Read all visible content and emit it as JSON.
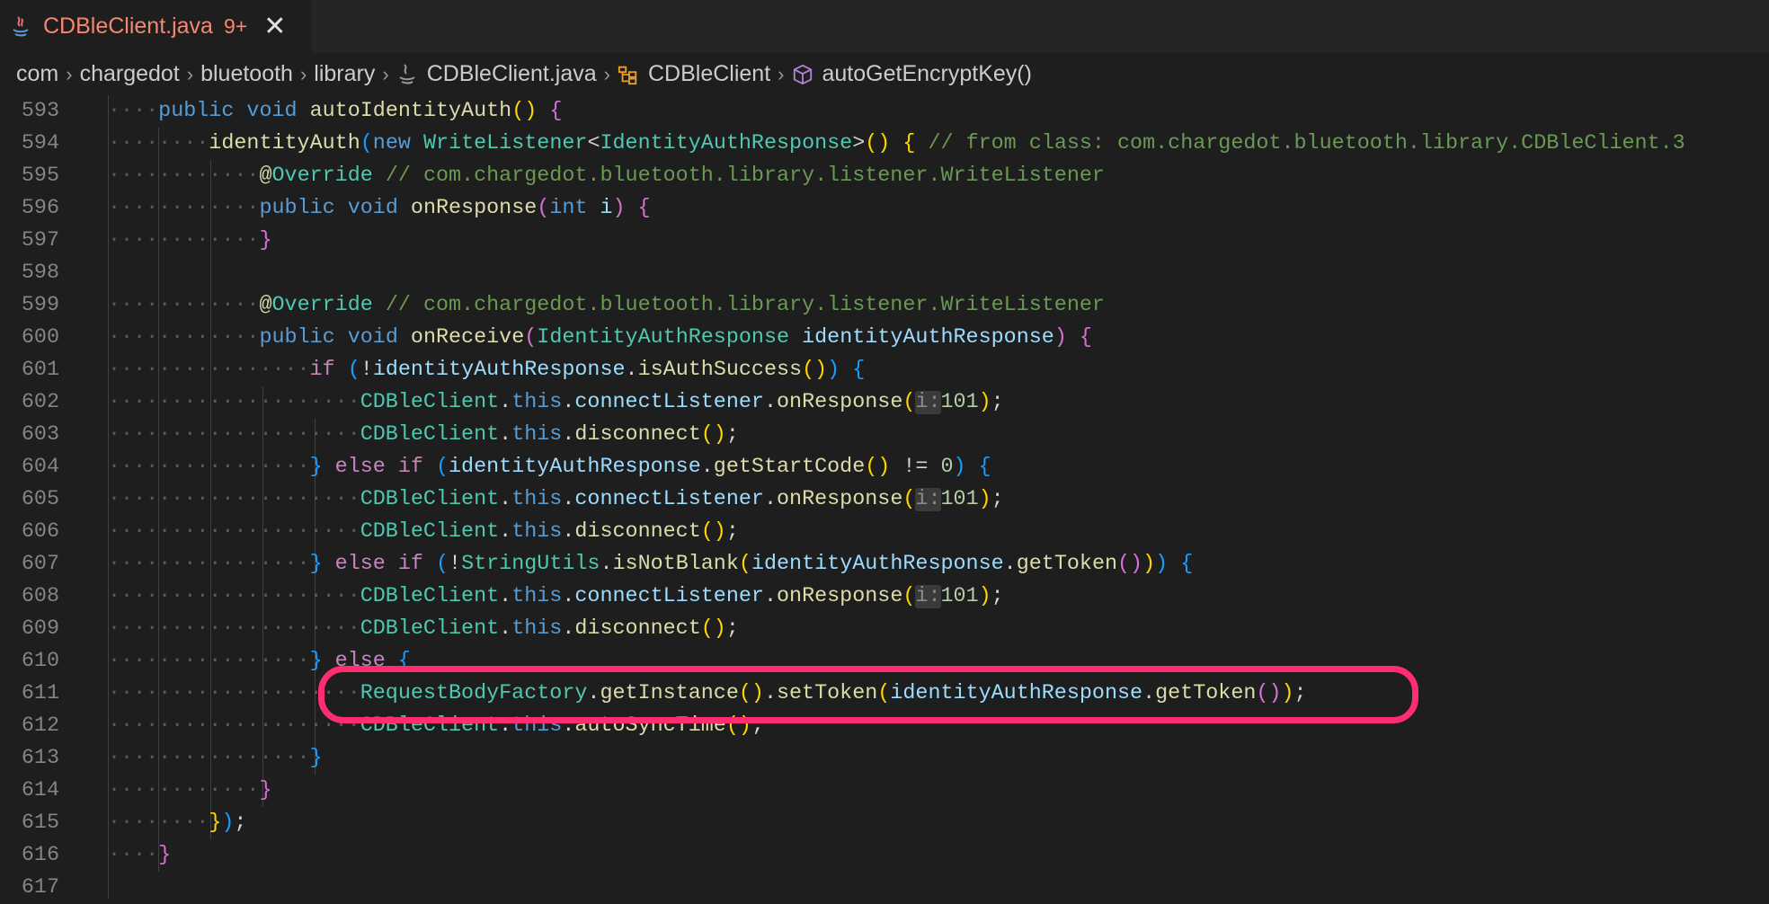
{
  "tab": {
    "title": "CDBleClient.java",
    "badge": "9+",
    "close": "✕"
  },
  "breadcrumb": {
    "items": [
      "com",
      "chargedot",
      "bluetooth",
      "library",
      "CDBleClient.java",
      "CDBleClient",
      "autoGetEncryptKey()"
    ]
  },
  "colors": {
    "highlight": "#ff2d6f",
    "tab_title": "#f48771"
  },
  "lines": [
    {
      "n": "593",
      "i": 1,
      "t": [
        [
          "kw",
          "public "
        ],
        [
          "kw",
          "void "
        ],
        [
          "fn",
          "autoIdentityAuth"
        ],
        [
          "b1",
          "() "
        ],
        [
          "b2",
          "{"
        ]
      ]
    },
    {
      "n": "594",
      "i": 2,
      "t": [
        [
          "fn",
          "identityAuth"
        ],
        [
          "b3",
          "("
        ],
        [
          "kw",
          "new "
        ],
        [
          "ty",
          "WriteListener"
        ],
        [
          "d",
          "<"
        ],
        [
          "ty",
          "IdentityAuthResponse"
        ],
        [
          "d",
          ">"
        ],
        [
          "b1",
          "() {"
        ],
        [
          "cm",
          " // from class: com.chargedot.bluetooth.library.CDBleClient.3"
        ]
      ]
    },
    {
      "n": "595",
      "i": 3,
      "t": [
        [
          "an",
          "@"
        ],
        [
          "ty",
          "Override"
        ],
        [
          "cm",
          " // com.chargedot.bluetooth.library.listener.WriteListener"
        ]
      ]
    },
    {
      "n": "596",
      "i": 3,
      "t": [
        [
          "kw",
          "public "
        ],
        [
          "kw",
          "void "
        ],
        [
          "fn",
          "onResponse"
        ],
        [
          "b2",
          "("
        ],
        [
          "kw",
          "int "
        ],
        [
          "var",
          "i"
        ],
        [
          "b2",
          ") {"
        ]
      ]
    },
    {
      "n": "597",
      "i": 3,
      "t": [
        [
          "b2",
          "}"
        ]
      ]
    },
    {
      "n": "598",
      "i": 0,
      "t": []
    },
    {
      "n": "599",
      "i": 3,
      "t": [
        [
          "an",
          "@"
        ],
        [
          "ty",
          "Override"
        ],
        [
          "cm",
          " // com.chargedot.bluetooth.library.listener.WriteListener"
        ]
      ]
    },
    {
      "n": "600",
      "i": 3,
      "t": [
        [
          "kw",
          "public "
        ],
        [
          "kw",
          "void "
        ],
        [
          "fn",
          "onReceive"
        ],
        [
          "b2",
          "("
        ],
        [
          "ty",
          "IdentityAuthResponse "
        ],
        [
          "var",
          "identityAuthResponse"
        ],
        [
          "b2",
          ") {"
        ]
      ]
    },
    {
      "n": "601",
      "i": 4,
      "t": [
        [
          "ctl",
          "if "
        ],
        [
          "b3",
          "("
        ],
        [
          "d",
          "!"
        ],
        [
          "var",
          "identityAuthResponse"
        ],
        [
          "d",
          "."
        ],
        [
          "fn",
          "isAuthSuccess"
        ],
        [
          "b1",
          "()"
        ],
        [
          "b3",
          ") {"
        ]
      ]
    },
    {
      "n": "602",
      "i": 5,
      "t": [
        [
          "ty",
          "CDBleClient"
        ],
        [
          "d",
          "."
        ],
        [
          "kw",
          "this"
        ],
        [
          "d",
          "."
        ],
        [
          "var",
          "connectListener"
        ],
        [
          "d",
          "."
        ],
        [
          "fn",
          "onResponse"
        ],
        [
          "b1",
          "("
        ],
        [
          "hint",
          "i:"
        ],
        [
          "nm",
          "101"
        ],
        [
          "b1",
          ")"
        ],
        [
          "d",
          ";"
        ]
      ]
    },
    {
      "n": "603",
      "i": 5,
      "t": [
        [
          "ty",
          "CDBleClient"
        ],
        [
          "d",
          "."
        ],
        [
          "kw",
          "this"
        ],
        [
          "d",
          "."
        ],
        [
          "fn",
          "disconnect"
        ],
        [
          "b1",
          "()"
        ],
        [
          "d",
          ";"
        ]
      ]
    },
    {
      "n": "604",
      "i": 4,
      "t": [
        [
          "b3",
          "} "
        ],
        [
          "ctl",
          "else if "
        ],
        [
          "b3",
          "("
        ],
        [
          "var",
          "identityAuthResponse"
        ],
        [
          "d",
          "."
        ],
        [
          "fn",
          "getStartCode"
        ],
        [
          "b1",
          "()"
        ],
        [
          "d",
          " != "
        ],
        [
          "nm",
          "0"
        ],
        [
          "b3",
          ") {"
        ]
      ]
    },
    {
      "n": "605",
      "i": 5,
      "t": [
        [
          "ty",
          "CDBleClient"
        ],
        [
          "d",
          "."
        ],
        [
          "kw",
          "this"
        ],
        [
          "d",
          "."
        ],
        [
          "var",
          "connectListener"
        ],
        [
          "d",
          "."
        ],
        [
          "fn",
          "onResponse"
        ],
        [
          "b1",
          "("
        ],
        [
          "hint",
          "i:"
        ],
        [
          "nm",
          "101"
        ],
        [
          "b1",
          ")"
        ],
        [
          "d",
          ";"
        ]
      ]
    },
    {
      "n": "606",
      "i": 5,
      "t": [
        [
          "ty",
          "CDBleClient"
        ],
        [
          "d",
          "."
        ],
        [
          "kw",
          "this"
        ],
        [
          "d",
          "."
        ],
        [
          "fn",
          "disconnect"
        ],
        [
          "b1",
          "()"
        ],
        [
          "d",
          ";"
        ]
      ]
    },
    {
      "n": "607",
      "i": 4,
      "t": [
        [
          "b3",
          "} "
        ],
        [
          "ctl",
          "else if "
        ],
        [
          "b3",
          "("
        ],
        [
          "d",
          "!"
        ],
        [
          "ty",
          "StringUtils"
        ],
        [
          "d",
          "."
        ],
        [
          "fn",
          "isNotBlank"
        ],
        [
          "b1",
          "("
        ],
        [
          "var",
          "identityAuthResponse"
        ],
        [
          "d",
          "."
        ],
        [
          "fn",
          "getToken"
        ],
        [
          "b2",
          "()"
        ],
        [
          "b1",
          ")"
        ],
        [
          "b3",
          ") {"
        ]
      ]
    },
    {
      "n": "608",
      "i": 5,
      "t": [
        [
          "ty",
          "CDBleClient"
        ],
        [
          "d",
          "."
        ],
        [
          "kw",
          "this"
        ],
        [
          "d",
          "."
        ],
        [
          "var",
          "connectListener"
        ],
        [
          "d",
          "."
        ],
        [
          "fn",
          "onResponse"
        ],
        [
          "b1",
          "("
        ],
        [
          "hint",
          "i:"
        ],
        [
          "nm",
          "101"
        ],
        [
          "b1",
          ")"
        ],
        [
          "d",
          ";"
        ]
      ]
    },
    {
      "n": "609",
      "i": 5,
      "t": [
        [
          "ty",
          "CDBleClient"
        ],
        [
          "d",
          "."
        ],
        [
          "kw",
          "this"
        ],
        [
          "d",
          "."
        ],
        [
          "fn",
          "disconnect"
        ],
        [
          "b1",
          "()"
        ],
        [
          "d",
          ";"
        ]
      ]
    },
    {
      "n": "610",
      "i": 4,
      "t": [
        [
          "b3",
          "} "
        ],
        [
          "ctl",
          "else "
        ],
        [
          "b3",
          "{"
        ]
      ]
    },
    {
      "n": "611",
      "i": 5,
      "t": [
        [
          "ty",
          "RequestBodyFactory"
        ],
        [
          "d",
          "."
        ],
        [
          "fn",
          "getInstance"
        ],
        [
          "b1",
          "()"
        ],
        [
          "d",
          "."
        ],
        [
          "fn",
          "setToken"
        ],
        [
          "b1",
          "("
        ],
        [
          "var",
          "identityAuthResponse"
        ],
        [
          "d",
          "."
        ],
        [
          "fn",
          "getToken"
        ],
        [
          "b2",
          "()"
        ],
        [
          "b1",
          ")"
        ],
        [
          "d",
          ";"
        ]
      ]
    },
    {
      "n": "612",
      "i": 5,
      "t": [
        [
          "ty",
          "CDBleClient"
        ],
        [
          "d",
          "."
        ],
        [
          "kw",
          "this"
        ],
        [
          "d",
          "."
        ],
        [
          "fn",
          "autoSyncTime"
        ],
        [
          "b1",
          "()"
        ],
        [
          "d",
          ";"
        ]
      ]
    },
    {
      "n": "613",
      "i": 4,
      "t": [
        [
          "b3",
          "}"
        ]
      ]
    },
    {
      "n": "614",
      "i": 3,
      "t": [
        [
          "b2",
          "}"
        ]
      ]
    },
    {
      "n": "615",
      "i": 2,
      "t": [
        [
          "b1",
          "}"
        ],
        [
          "b3",
          ")"
        ],
        [
          "d",
          ";"
        ]
      ]
    },
    {
      "n": "616",
      "i": 1,
      "t": [
        [
          "b2",
          "}"
        ]
      ]
    },
    {
      "n": "617",
      "i": 0,
      "t": []
    }
  ]
}
